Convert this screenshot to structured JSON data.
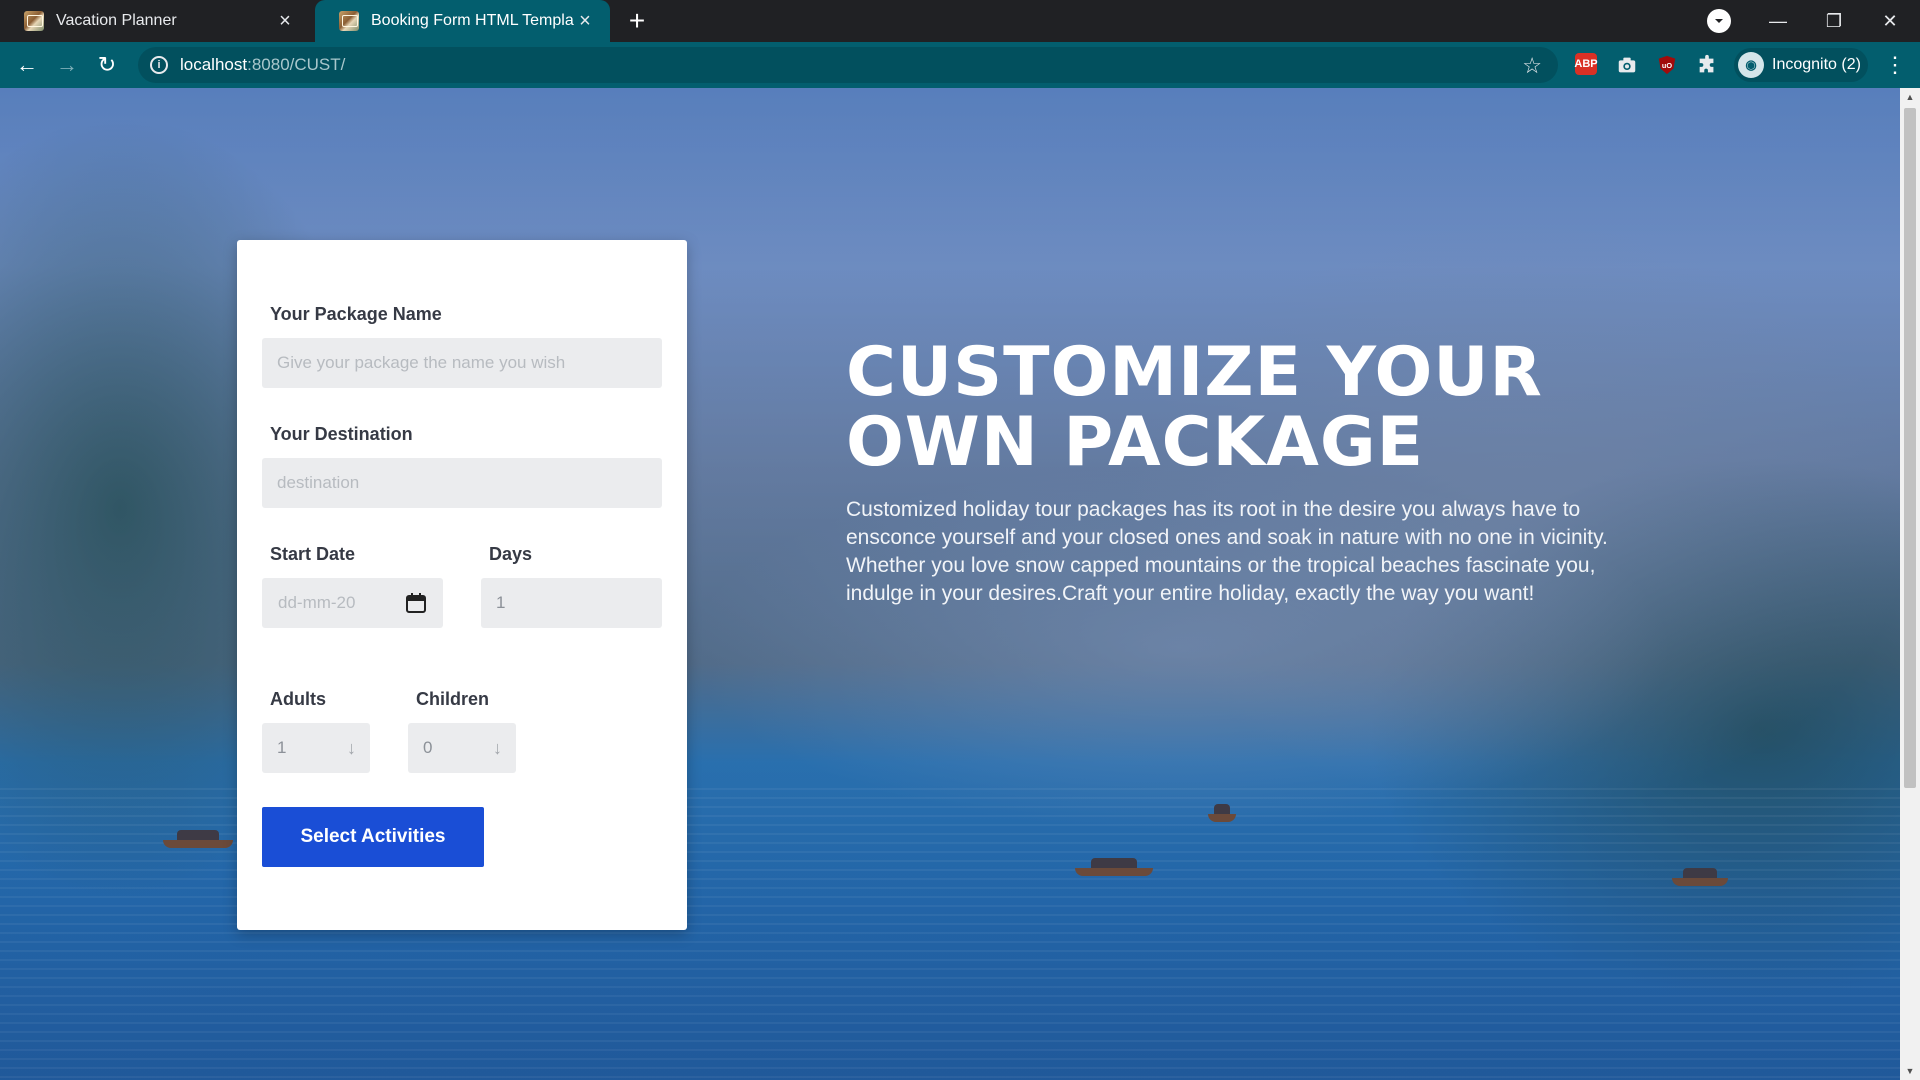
{
  "browser": {
    "tabs": [
      {
        "title": "Vacation Planner",
        "active": false
      },
      {
        "title": "Booking Form HTML Template",
        "active": true
      }
    ],
    "url_host": "localhost",
    "url_path": ":8080/CUST/",
    "profile_label": "Incognito (2)",
    "extensions": [
      "adblock-icon",
      "camera-icon",
      "ublock-icon",
      "puzzle-icon"
    ]
  },
  "form": {
    "package_name": {
      "label": "Your Package Name",
      "placeholder": "Give your package the name you wish"
    },
    "destination": {
      "label": "Your Destination",
      "placeholder": "destination"
    },
    "start_date": {
      "label": "Start Date",
      "placeholder": "dd-mm-20"
    },
    "days": {
      "label": "Days",
      "value": "1"
    },
    "adults": {
      "label": "Adults",
      "value": "1"
    },
    "children": {
      "label": "Children",
      "value": "0"
    },
    "submit_label": "Select Activities"
  },
  "hero": {
    "title_line1": "CUSTOMIZE YOUR",
    "title_line2": "OWN PACKAGE",
    "description": "Customized holiday tour packages has its root in the desire you always have to ensconce yourself and your closed ones and soak in nature with no one in vicinity. Whether you love snow capped mountains or the tropical beaches fascinate you, indulge in your desires.Craft your entire holiday, exactly the way you want!"
  },
  "colors": {
    "toolbar": "#035e6e",
    "button": "#1a4ed6",
    "overlay": "#2850a0"
  }
}
